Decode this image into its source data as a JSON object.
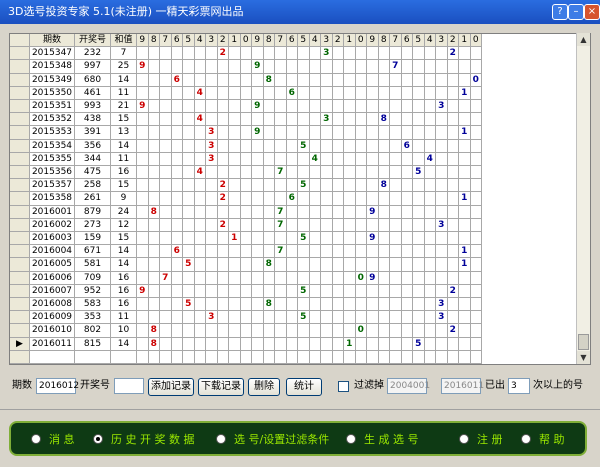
{
  "window": {
    "title": "3D选号投资专家 5.1(未注册) 一精天彩票网出品",
    "help_label": "?",
    "min_label": "–",
    "close_label": "×"
  },
  "colors": {
    "digit_colors": [
      "#cc0000",
      "#006600",
      "#000099"
    ]
  },
  "grid": {
    "headers": [
      "期数",
      "开奖号",
      "和值",
      "9",
      "8",
      "7",
      "6",
      "5",
      "4",
      "3",
      "2",
      "1",
      "0",
      "9",
      "8",
      "7",
      "6",
      "5",
      "4",
      "3",
      "2",
      "1",
      "0",
      "9",
      "8",
      "7",
      "6",
      "5",
      "4",
      "3",
      "2",
      "1",
      "0"
    ],
    "rows": [
      {
        "period": "2015347",
        "number": "232",
        "sum": "7",
        "d1": 2,
        "d2": 3,
        "d3": 2
      },
      {
        "period": "2015348",
        "number": "997",
        "sum": "25",
        "d1": 9,
        "d2": 9,
        "d3": 7
      },
      {
        "period": "2015349",
        "number": "680",
        "sum": "14",
        "d1": 6,
        "d2": 8,
        "d3": 0
      },
      {
        "period": "2015350",
        "number": "461",
        "sum": "11",
        "d1": 4,
        "d2": 6,
        "d3": 1
      },
      {
        "period": "2015351",
        "number": "993",
        "sum": "21",
        "d1": 9,
        "d2": 9,
        "d3": 3
      },
      {
        "period": "2015352",
        "number": "438",
        "sum": "15",
        "d1": 4,
        "d2": 3,
        "d3": 8
      },
      {
        "period": "2015353",
        "number": "391",
        "sum": "13",
        "d1": 3,
        "d2": 9,
        "d3": 1
      },
      {
        "period": "2015354",
        "number": "356",
        "sum": "14",
        "d1": 3,
        "d2": 5,
        "d3": 6
      },
      {
        "period": "2015355",
        "number": "344",
        "sum": "11",
        "d1": 3,
        "d2": 4,
        "d3": 4
      },
      {
        "period": "2015356",
        "number": "475",
        "sum": "16",
        "d1": 4,
        "d2": 7,
        "d3": 5
      },
      {
        "period": "2015357",
        "number": "258",
        "sum": "15",
        "d1": 2,
        "d2": 5,
        "d3": 8
      },
      {
        "period": "2015358",
        "number": "261",
        "sum": "9",
        "d1": 2,
        "d2": 6,
        "d3": 1
      },
      {
        "period": "2016001",
        "number": "879",
        "sum": "24",
        "d1": 8,
        "d2": 7,
        "d3": 9
      },
      {
        "period": "2016002",
        "number": "273",
        "sum": "12",
        "d1": 2,
        "d2": 7,
        "d3": 3
      },
      {
        "period": "2016003",
        "number": "159",
        "sum": "15",
        "d1": 1,
        "d2": 5,
        "d3": 9
      },
      {
        "period": "2016004",
        "number": "671",
        "sum": "14",
        "d1": 6,
        "d2": 7,
        "d3": 1
      },
      {
        "period": "2016005",
        "number": "581",
        "sum": "14",
        "d1": 5,
        "d2": 8,
        "d3": 1
      },
      {
        "period": "2016006",
        "number": "709",
        "sum": "16",
        "d1": 7,
        "d2": 0,
        "d3": 9
      },
      {
        "period": "2016007",
        "number": "952",
        "sum": "16",
        "d1": 9,
        "d2": 5,
        "d3": 2
      },
      {
        "period": "2016008",
        "number": "583",
        "sum": "16",
        "d1": 5,
        "d2": 8,
        "d3": 3
      },
      {
        "period": "2016009",
        "number": "353",
        "sum": "11",
        "d1": 3,
        "d2": 5,
        "d3": 3
      },
      {
        "period": "2016010",
        "number": "802",
        "sum": "10",
        "d1": 8,
        "d2": 0,
        "d3": 2
      },
      {
        "period": "2016011",
        "number": "815",
        "sum": "14",
        "d1": 8,
        "d2": 1,
        "d3": 5
      }
    ],
    "current_row_marker": "▶"
  },
  "controls": {
    "period_label": "期数",
    "period_value": "2016012",
    "number_label": "开奖号",
    "number_value": "",
    "add_button": "添加记录",
    "download_button": "下载记录",
    "delete_button": "删除",
    "stats_button": "统计",
    "filter_label": "过滤掉",
    "filter_from": "2004001",
    "filter_to": "2016011",
    "occurred_label": "已出",
    "occurred_value": "3",
    "times_label": "次以上的号"
  },
  "nav": {
    "items": [
      {
        "label": "消 息",
        "selected": false
      },
      {
        "label": "历 史 开 奖 数 据",
        "selected": true
      },
      {
        "label": "选 号/设置过滤条件",
        "selected": false
      },
      {
        "label": "生 成 选 号",
        "selected": false
      },
      {
        "label": "注 册",
        "selected": false
      },
      {
        "label": "帮 助",
        "selected": false
      }
    ]
  }
}
